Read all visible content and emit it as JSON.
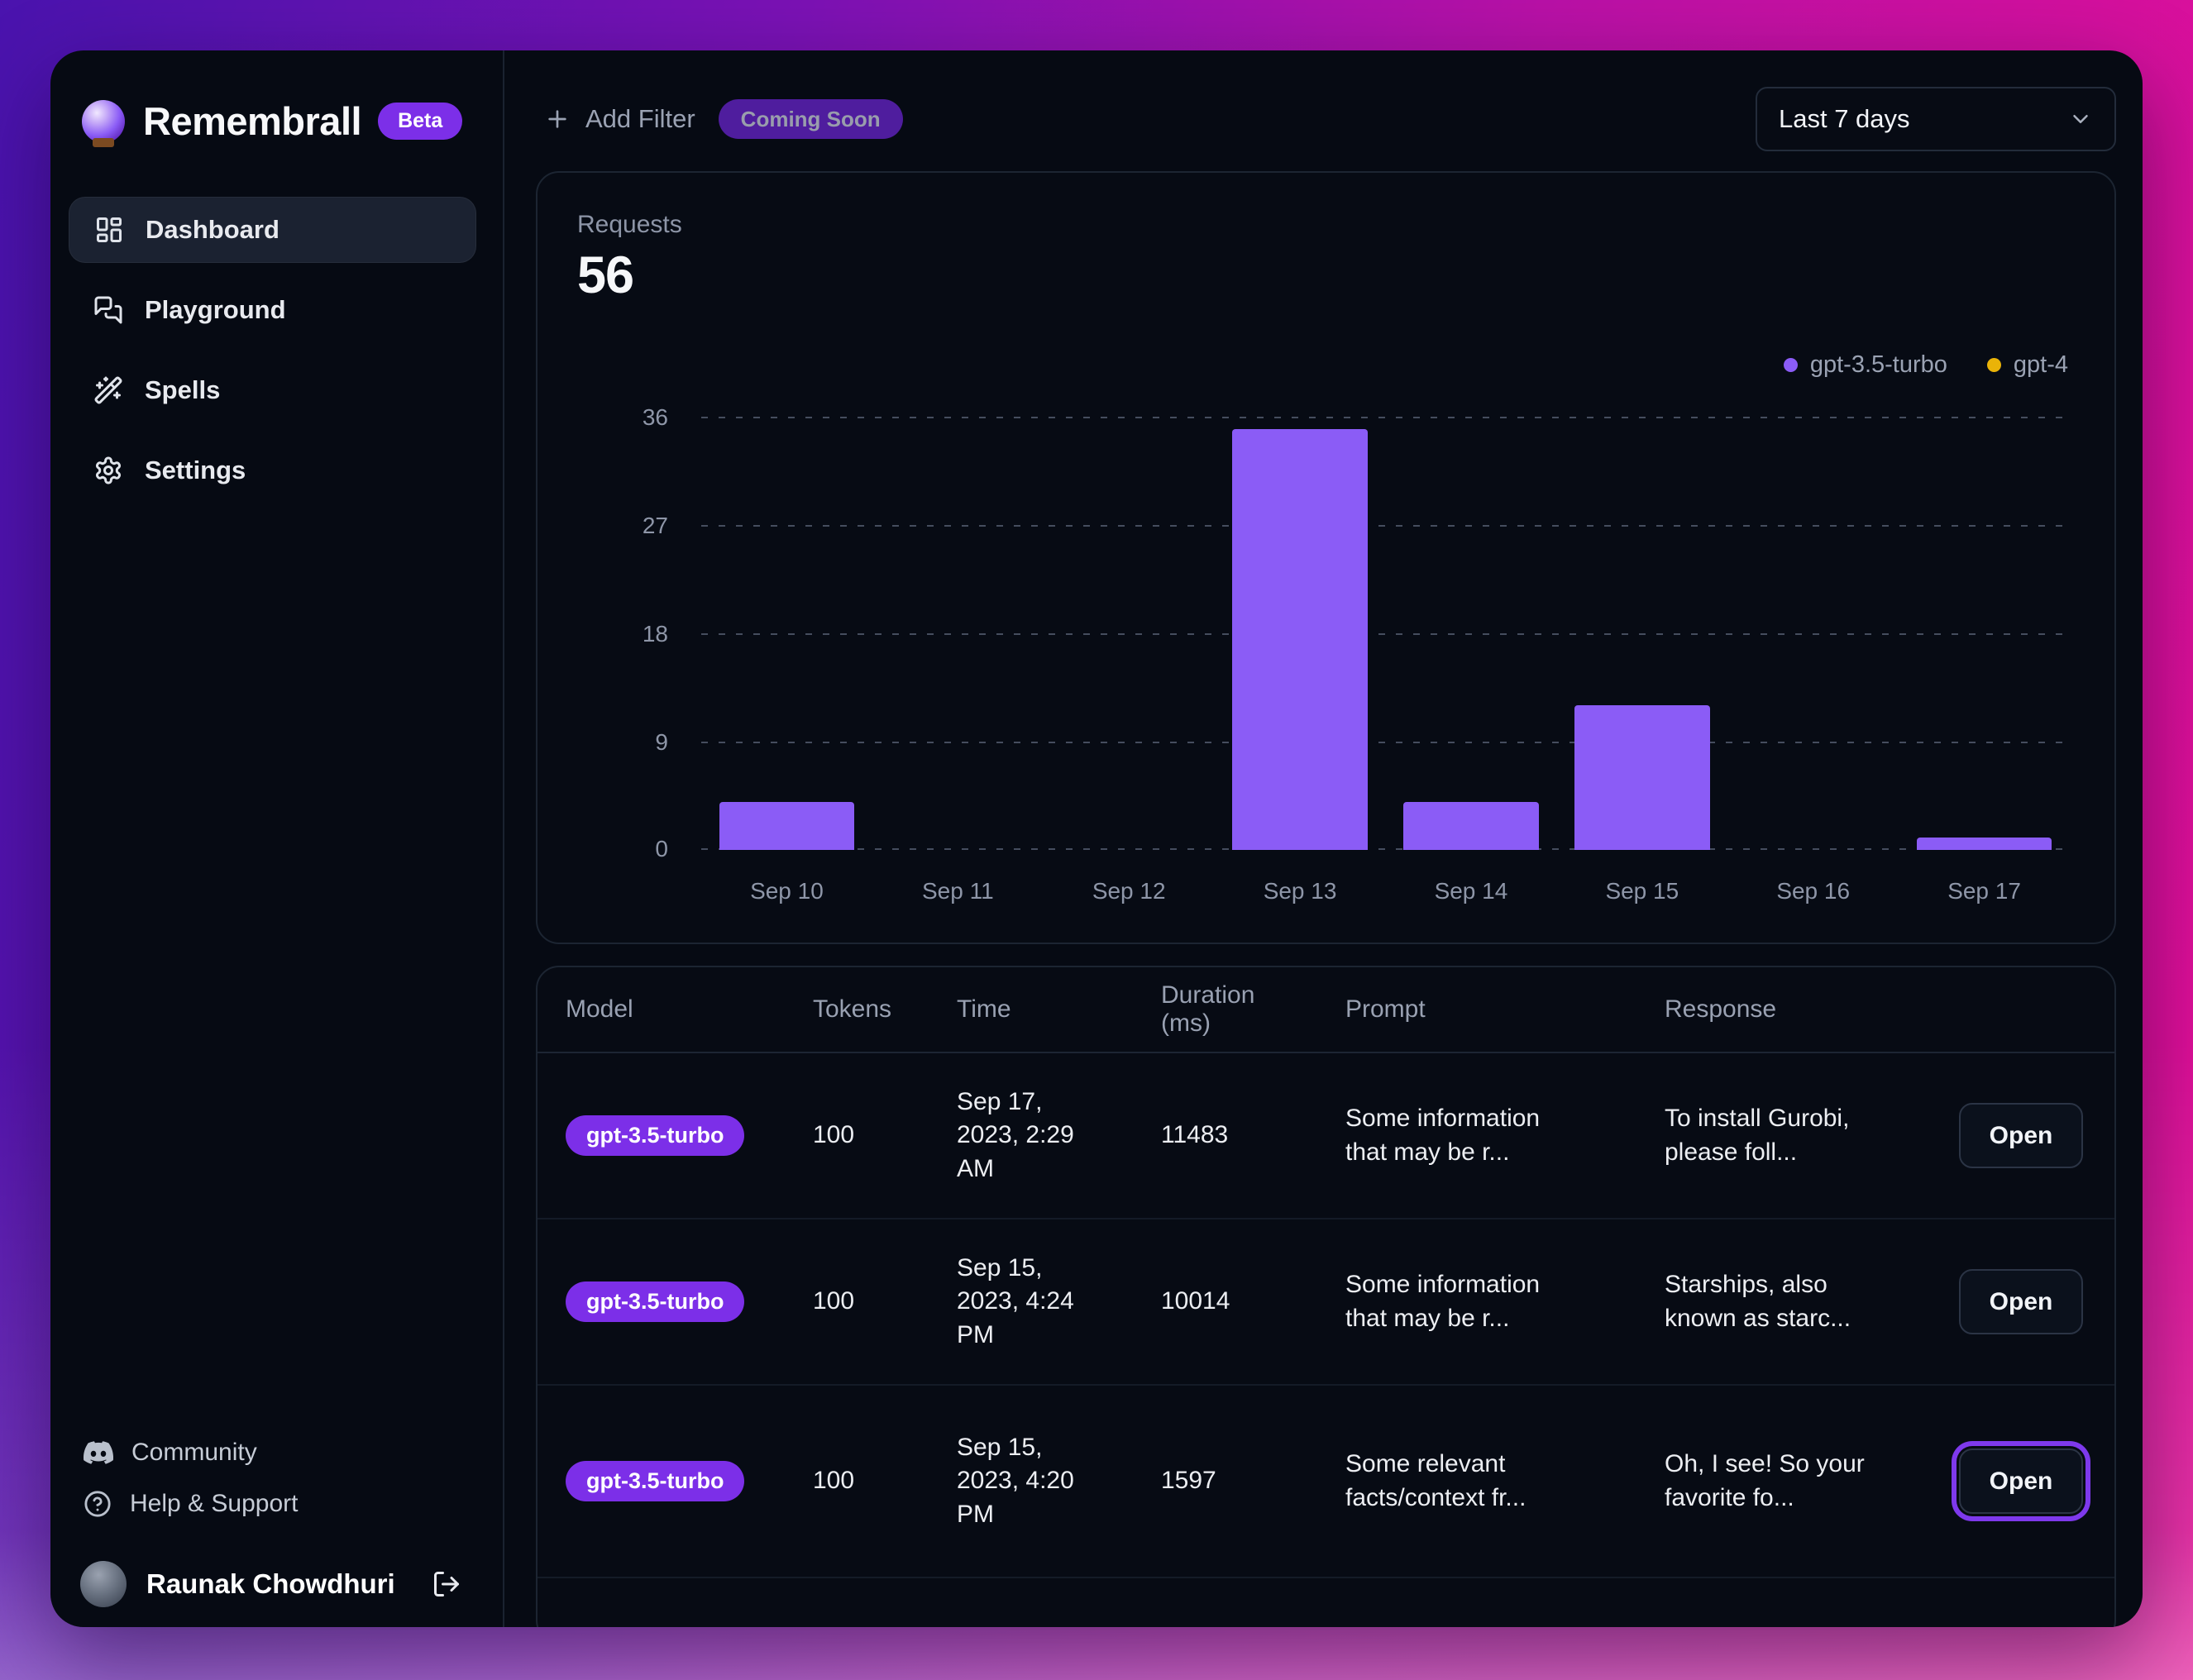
{
  "app": {
    "name": "Remembrall",
    "beta_label": "Beta"
  },
  "sidebar": {
    "items": [
      {
        "label": "Dashboard",
        "icon": "dashboard-icon",
        "active": true
      },
      {
        "label": "Playground",
        "icon": "playground-icon",
        "active": false
      },
      {
        "label": "Spells",
        "icon": "spells-icon",
        "active": false
      },
      {
        "label": "Settings",
        "icon": "settings-icon",
        "active": false
      }
    ],
    "footer_items": [
      {
        "label": "Community",
        "icon": "discord-icon"
      },
      {
        "label": "Help & Support",
        "icon": "help-icon"
      }
    ],
    "user": {
      "name": "Raunak Chowdhuri",
      "logout_icon": "logout-icon"
    }
  },
  "topbar": {
    "add_filter_label": "Add Filter",
    "coming_soon_label": "Coming Soon",
    "date_range_value": "Last 7 days"
  },
  "chart_card": {
    "metric_label": "Requests",
    "metric_value": "56"
  },
  "chart_data": {
    "type": "bar",
    "title": "Requests",
    "total_requests": 56,
    "categories": [
      "Sep 10",
      "Sep 11",
      "Sep 12",
      "Sep 13",
      "Sep 14",
      "Sep 15",
      "Sep 16",
      "Sep 17"
    ],
    "series": [
      {
        "name": "gpt-3.5-turbo",
        "color": "#8b5cf6",
        "values": [
          4,
          0,
          0,
          35,
          4,
          12,
          0,
          1
        ]
      },
      {
        "name": "gpt-4",
        "color": "#eab308",
        "values": [
          0,
          0,
          0,
          0,
          0,
          0,
          0,
          0
        ]
      }
    ],
    "ylim": [
      0,
      36
    ],
    "yticks": [
      0,
      9,
      18,
      27,
      36
    ],
    "grid": "dashed-horizontal",
    "legend_position": "top-right"
  },
  "table": {
    "columns": [
      "Model",
      "Tokens",
      "Time",
      "Duration (ms)",
      "Prompt",
      "Response"
    ],
    "open_label": "Open",
    "rows": [
      {
        "model": "gpt-3.5-turbo",
        "tokens": "100",
        "time": "Sep 17, 2023, 2:29 AM",
        "duration_ms": "11483",
        "prompt": "Some information that may be r...",
        "response": "To install Gurobi, please foll...",
        "open_focused": false
      },
      {
        "model": "gpt-3.5-turbo",
        "tokens": "100",
        "time": "Sep 15, 2023, 4:24 PM",
        "duration_ms": "10014",
        "prompt": "Some information that may be r...",
        "response": "Starships, also known as starc...",
        "open_focused": false
      },
      {
        "model": "gpt-3.5-turbo",
        "tokens": "100",
        "time": "Sep 15, 2023, 4:20 PM",
        "duration_ms": "1597",
        "prompt": "Some relevant facts/context fr...",
        "response": "Oh, I see! So your favorite fo...",
        "open_focused": true
      }
    ]
  },
  "colors": {
    "accent_purple": "#7c2fe8",
    "bar_purple": "#8b5cf6",
    "gpt4_yellow": "#eab308",
    "window_bg": "#060a13",
    "card_border": "#1c2532",
    "muted_text": "#9aa2b3",
    "background_gradient": [
      "#4a13ae",
      "#e60f97"
    ]
  }
}
